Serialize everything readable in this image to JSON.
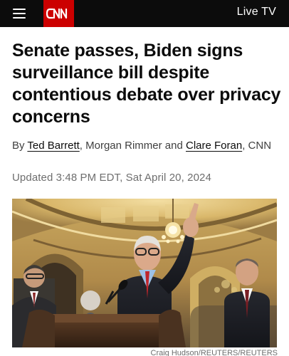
{
  "header": {
    "logo_text": "CNN",
    "live_tv_label": "Live TV",
    "accent_color": "#cc0000",
    "background_color": "#0c0c0c",
    "menu_icon": "hamburger-menu-icon"
  },
  "article": {
    "headline": "Senate passes, Biden signs surveillance bill despite contentious debate over privacy concerns",
    "byline": {
      "prefix": "By ",
      "author_1": "Ted Barrett",
      "sep_1": ", Morgan Rimmer and ",
      "author_2": "Clare Foran",
      "suffix": ", CNN"
    },
    "updated": "Updated 3:48 PM EDT, Sat April 20, 2024",
    "photo_credit": "Craig Hudson/REUTERS/REUTERS"
  }
}
